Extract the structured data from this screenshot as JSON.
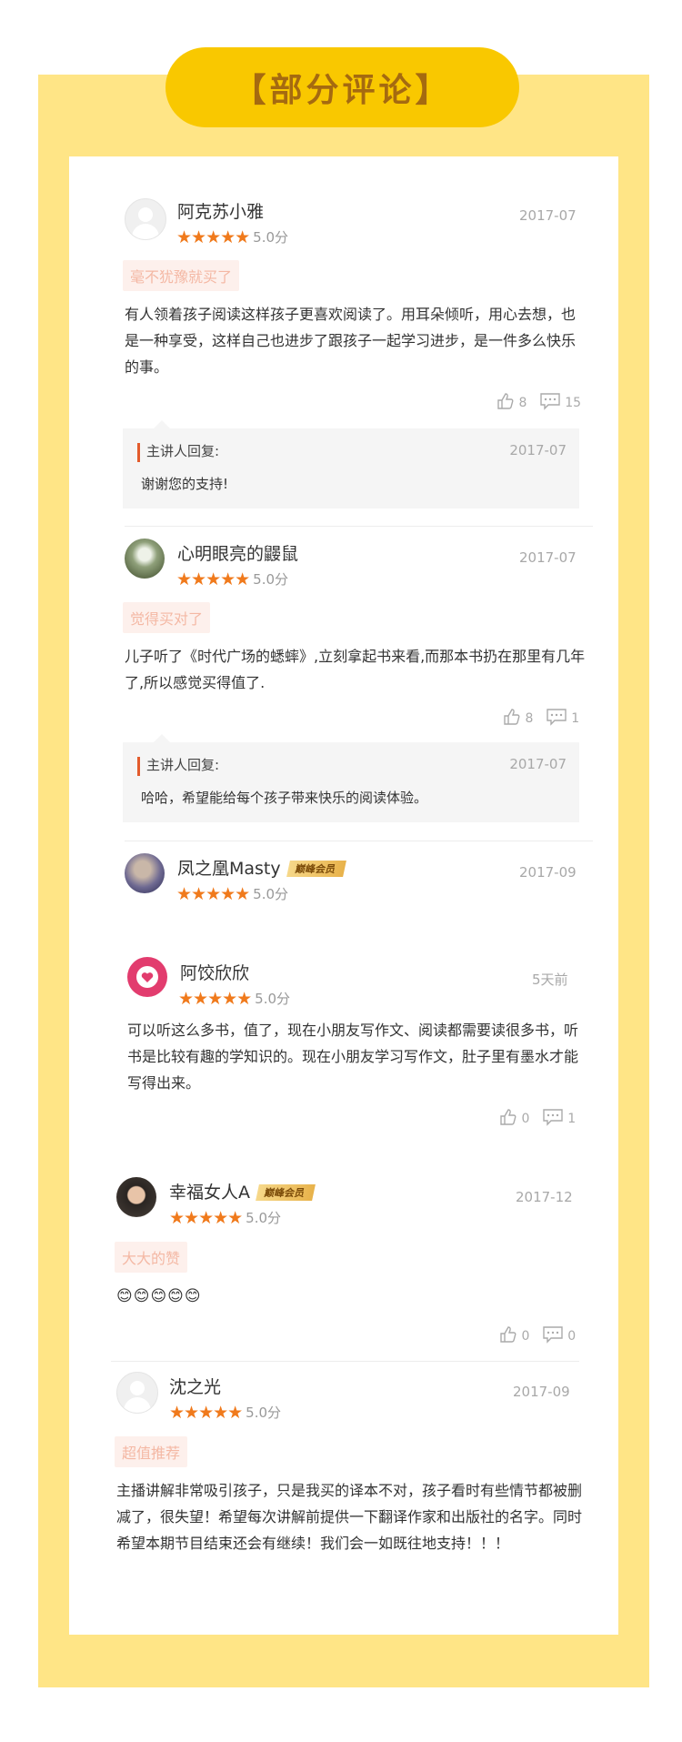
{
  "header": {
    "title": "【部分评论】"
  },
  "reviews": [
    {
      "name": "阿克苏小雅",
      "stars": "★★★★★",
      "score": "5.0分",
      "date": "2017-07",
      "tag": "毫不犹豫就买了",
      "content": "有人领着孩子阅读这样孩子更喜欢阅读了。用耳朵倾听，用心去想，也是一种享受，这样自己也进步了跟孩子一起学习进步，是一件多么快乐的事。",
      "likes": "8",
      "comments": "15",
      "reply": {
        "author": "主讲人回复:",
        "date": "2017-07",
        "text": "谢谢您的支持!"
      }
    },
    {
      "name": "心明眼亮的鼹鼠",
      "stars": "★★★★★",
      "score": "5.0分",
      "date": "2017-07",
      "tag": "觉得买对了",
      "content": "儿子听了《时代广场的蟋蟀》,立刻拿起书来看,而那本书扔在那里有几年了,所以感觉买得值了.",
      "likes": "8",
      "comments": "1",
      "reply": {
        "author": "主讲人回复:",
        "date": "2017-07",
        "text": "哈哈，希望能给每个孩子带来快乐的阅读体验。"
      }
    },
    {
      "name": "凤之凰Masty",
      "badge": "巅峰会员",
      "stars": "★★★★★",
      "score": "5.0分",
      "date": "2017-09"
    },
    {
      "name": "阿饺欣欣",
      "stars": "★★★★★",
      "score": "5.0分",
      "date": "5天前",
      "content": "可以听这么多书，值了，现在小朋友写作文、阅读都需要读很多书，听书是比较有趣的学知识的。现在小朋友学习写作文，肚子里有墨水才能写得出来。",
      "likes": "0",
      "comments": "1"
    },
    {
      "name": "幸福女人A",
      "badge": "巅峰会员",
      "stars": "★★★★★",
      "score": "5.0分",
      "date": "2017-12",
      "tag": "大大的赞",
      "content": "😊😊😊😊😊",
      "likes": "0",
      "comments": "0"
    },
    {
      "name": "沈之光",
      "stars": "★★★★★",
      "score": "5.0分",
      "date": "2017-09",
      "tag": "超值推荐",
      "content": "主播讲解非常吸引孩子，只是我买的译本不对，孩子看时有些情节都被删减了，很失望！希望每次讲解前提供一下翻译作家和出版社的名字。同时希望本期节目结束还会有继续！我们会一如既往地支持！！！"
    }
  ],
  "colors": {
    "frame": "#ffe586",
    "title_bg": "#f9c800",
    "title_text": "#a56a10",
    "star": "#f07a1c",
    "tag_bg": "#fdf0ec",
    "reply_bar": "#e35b2c"
  },
  "icons": {
    "like": "thumbs-up-icon",
    "comment": "comment-icon"
  }
}
